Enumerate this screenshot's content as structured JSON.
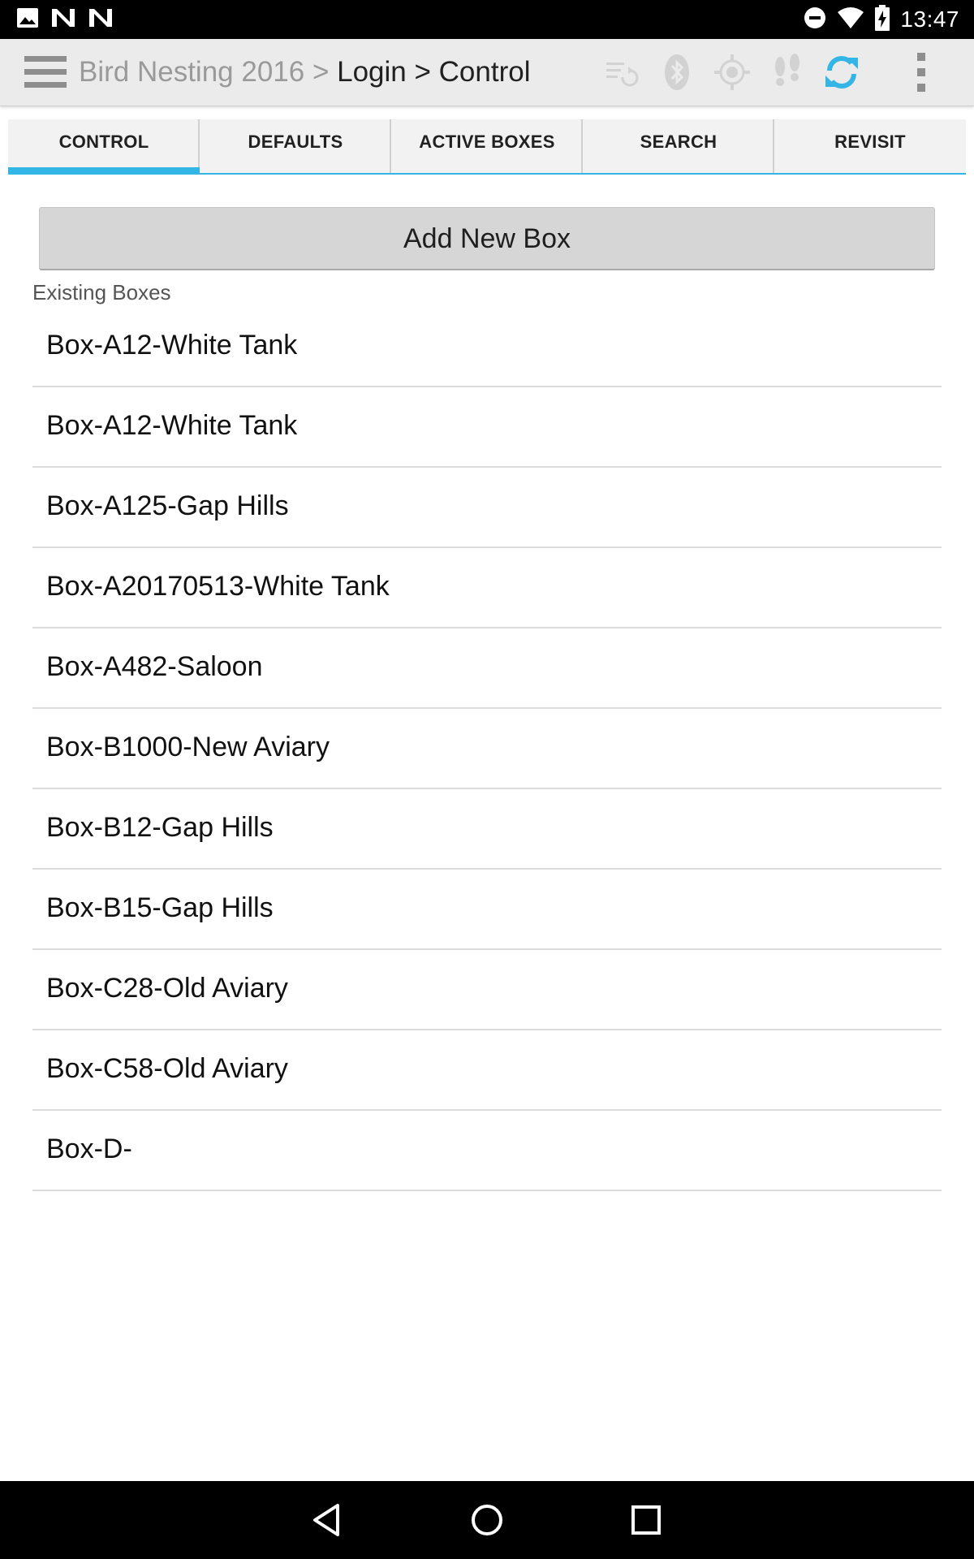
{
  "status_bar": {
    "time": "13:47",
    "left_icons": [
      "image-icon",
      "n-notification-icon",
      "n-notification-icon"
    ],
    "right_icons": [
      "do-not-disturb-icon",
      "wifi-icon",
      "battery-charging-icon"
    ]
  },
  "action_bar": {
    "breadcrumb": {
      "project": "Bird Nesting 2016",
      "sep1": " > ",
      "login": "Login",
      "sep2": " > ",
      "current": "Control"
    },
    "icons": [
      "sync-list-icon",
      "bluetooth-icon",
      "gps-target-icon",
      "footsteps-icon",
      "refresh-icon",
      "overflow-menu-icon"
    ],
    "accent_color": "#33b5e5"
  },
  "tabs": [
    {
      "label": "CONTROL",
      "selected": true
    },
    {
      "label": "DEFAULTS",
      "selected": false
    },
    {
      "label": "ACTIVE BOXES",
      "selected": false
    },
    {
      "label": "SEARCH",
      "selected": false
    },
    {
      "label": "REVISIT",
      "selected": false
    }
  ],
  "control": {
    "add_button_label": "Add New Box",
    "section_label": "Existing Boxes",
    "boxes": [
      "Box-A12-White Tank",
      "Box-A12-White Tank",
      "Box-A125-Gap Hills",
      "Box-A20170513-White Tank",
      "Box-A482-Saloon",
      "Box-B1000-New Aviary",
      "Box-B12-Gap Hills",
      "Box-B15-Gap Hills",
      "Box-C28-Old Aviary",
      "Box-C58-Old Aviary",
      "Box-D-"
    ]
  },
  "nav_bar": {
    "buttons": [
      "back-icon",
      "home-icon",
      "recents-icon"
    ]
  }
}
